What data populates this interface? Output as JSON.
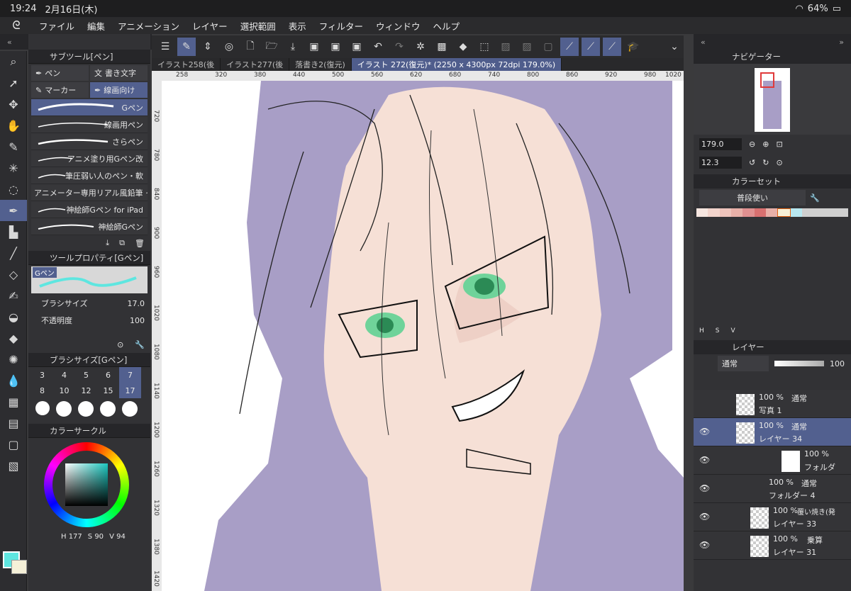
{
  "status": {
    "time": "19:24",
    "date": "2月16日(木)",
    "battery": "64%"
  },
  "menu": [
    "ファイル",
    "編集",
    "アニメーション",
    "レイヤー",
    "選択範囲",
    "表示",
    "フィルター",
    "ウィンドウ",
    "ヘルプ"
  ],
  "subtool": {
    "title": "サブツール[ペン]",
    "tabs": [
      "ペン",
      "書き文字",
      "マーカー",
      "線画向け"
    ],
    "brushes": [
      "Gペン",
      "線画用ペン",
      "さらペン",
      "アニメ塗り用Gペン改",
      "筆圧弱い人のペン・軟",
      "アニメーター専用リアル風鉛筆 そ",
      "神絵師Gペン for iPad",
      "神絵師Gペン"
    ]
  },
  "toolprop": {
    "title": "ツールプロパティ[Gペン]",
    "preview": "Gペン",
    "size_label": "ブラシサイズ",
    "size_value": "17.0",
    "opacity_label": "不透明度",
    "opacity_value": "100"
  },
  "brushsize": {
    "title": "ブラシサイズ[Gペン]",
    "values": [
      "3",
      "4",
      "5",
      "6",
      "7",
      "8",
      "10",
      "12",
      "15",
      "17"
    ]
  },
  "colorcircle": {
    "title": "カラーサークル",
    "h": "H 177",
    "s": "S  90",
    "v": "V  94"
  },
  "doctabs": [
    "イラスト258(後",
    "イラスト277(後",
    "落書き2(復元)",
    "イラスト 272(復元)* (2250 x 4300px 72dpi 179.0%)"
  ],
  "ruler_h": [
    "258",
    "320",
    "380",
    "440",
    "500",
    "560",
    "620",
    "680",
    "740",
    "800",
    "860",
    "920",
    "980",
    "1020"
  ],
  "ruler_v": [
    "720",
    "780",
    "840",
    "900",
    "960",
    "1020",
    "1080",
    "1140",
    "1200",
    "1260",
    "1320",
    "1380",
    "1420"
  ],
  "navigator": {
    "title": "ナビゲーター",
    "zoom": "179.0",
    "angle": "12.3"
  },
  "colorset": {
    "title": "カラーセット",
    "set_name": "普段使い",
    "hsv": [
      "H",
      "S",
      "V"
    ]
  },
  "layers": {
    "title": "レイヤー",
    "blend": "通常",
    "opacity": "100",
    "items": [
      {
        "pct": "100 %",
        "mode": "通常",
        "name": "写真 1"
      },
      {
        "pct": "100 %",
        "mode": "通常",
        "name": "レイヤー 34"
      },
      {
        "pct": "100 %",
        "mode": "",
        "name": "フォルダ"
      },
      {
        "pct": "100 %",
        "mode": "通常",
        "name": "フォルダー 4"
      },
      {
        "pct": "100 %",
        "mode": "覆い焼き(発",
        "name": "レイヤー 33"
      },
      {
        "pct": "100 %",
        "mode": "乗算",
        "name": "レイヤー 31"
      }
    ]
  },
  "colors": {
    "accent": "#52608f",
    "main_color": "#5ee6e0",
    "sub_color": "#f5f0d8",
    "hair_shadow": "#a89ec6",
    "skin": "#f6e0d6"
  }
}
